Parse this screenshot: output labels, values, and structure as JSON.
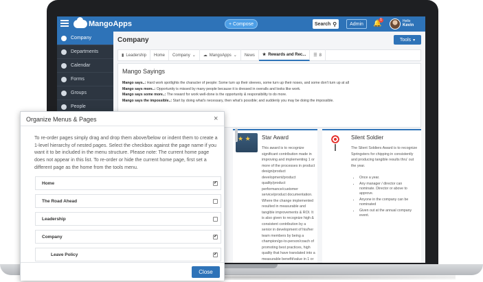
{
  "topbar": {
    "logo_text": "MangoApps",
    "compose_label": "+ Compose",
    "search_label": "Search",
    "admin_label": "Admin",
    "notification_count": "1",
    "hello_text": "Hello",
    "user_name": "Kevin"
  },
  "sidebar": {
    "items": [
      {
        "label": "Company",
        "icon": "globe-icon"
      },
      {
        "label": "Departments",
        "icon": "departments-icon"
      },
      {
        "label": "Calendar",
        "icon": "calendar-icon"
      },
      {
        "label": "Forms",
        "icon": "forms-icon"
      },
      {
        "label": "Groups",
        "icon": "groups-icon"
      },
      {
        "label": "People",
        "icon": "people-icon"
      }
    ]
  },
  "main": {
    "page_title": "Company",
    "tools_label": "Tools",
    "tabs": [
      {
        "label": "Leadership"
      },
      {
        "label": "Home"
      },
      {
        "label": "Company"
      },
      {
        "label": "MangoApps"
      },
      {
        "label": "News"
      },
      {
        "label": "Rewards and Rec..."
      },
      {
        "label": "8"
      }
    ],
    "panel_title": "Mango Sayings",
    "sayings": [
      {
        "lead": "Mango says..:",
        "text": " Hard work spotlights the character of people: Some turn up their sleeves, some turn up their noses, and some don't turn up at all"
      },
      {
        "lead": "Mango says more..:",
        "text": " Opportunity is missed by many people because it is dressed in overalls and looks like work."
      },
      {
        "lead": "Mango says some more..:",
        "text": " The reward for work well-done is the opportunity & responsibility to do more."
      },
      {
        "lead": "Mango says the impossible..:",
        "text": " Start by doing what's necessary, then what's possible; and suddenly you may be doing the impossible."
      }
    ],
    "awards": {
      "star": {
        "name": "Star Award",
        "desc": "This award is to recognize significant contribution made in improving and implementing 1 or more of the processes in product design/product development/product quality/product performance/customer service/product documentation. Where the change implemented resulted in measurable and tangible improvements & ROI. It is also given to recognize high & consistent contribution by a senior in development of his/her team members by being a champion/go-to-person/coach of promoting best practices, high quality that have translated into a measurable benefit/value in 1 or more of these areas of product"
      },
      "silent": {
        "name": "Silent Soldier",
        "desc": "The Silent Soldiers Award is to recognize Springsters for chipping in consistently and producing tangible results thru' out the year.",
        "bullets": [
          "Once a year.",
          "Any manager / director can nominate. Director or above to approve.",
          "Anyone in the company can be nominated",
          "Given out at the annual company event."
        ]
      }
    }
  },
  "modal": {
    "title": "Organize Menus & Pages",
    "close_x": "×",
    "instructions": "To re-order pages simply drag and drop them above/below or indent them to create a 1-level hierarchy of nested pages. Select the checkbox against the page name if you want it to be included in the menu structure. Please note: The current home page does not appear in this list. To re-order or hide the current home page, first set a different page as the home from the tools menu.",
    "rows": [
      {
        "label": "Home",
        "checked": "✔"
      },
      {
        "label": "The Road Ahead",
        "checked": ""
      },
      {
        "label": "Leadership",
        "checked": ""
      },
      {
        "label": "Company",
        "checked": "✔"
      },
      {
        "label": "Leave Policy",
        "checked": "✔"
      }
    ],
    "close_label": "Close"
  },
  "colors": {
    "brand_blue": "#2e73b8",
    "sidebar_dark": "#2d3641"
  }
}
